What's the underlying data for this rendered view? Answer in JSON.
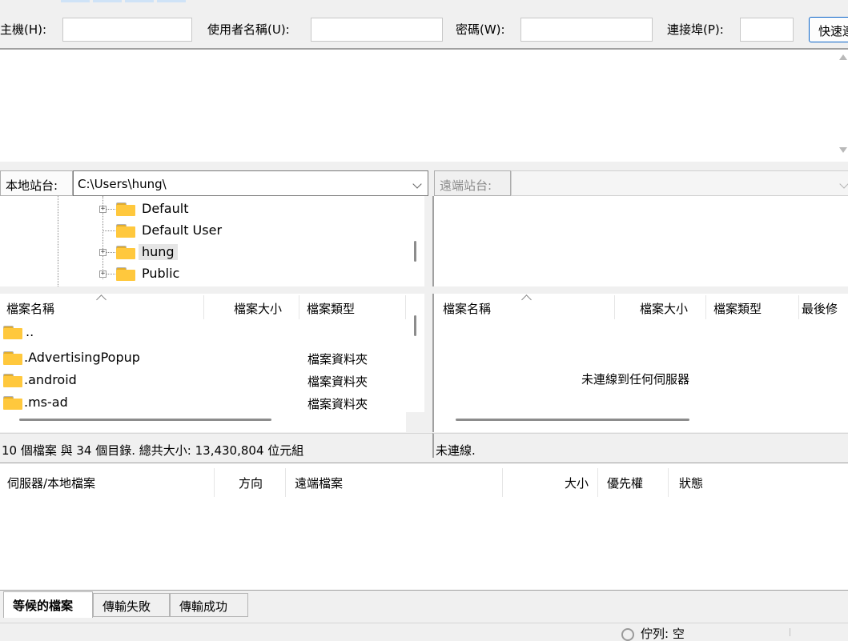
{
  "quickconnect": {
    "host_label": "主機(H):",
    "user_label": "使用者名稱(U):",
    "pass_label": "密碼(W):",
    "port_label": "連接埠(P):",
    "host_value": "",
    "user_value": "",
    "pass_value": "",
    "port_value": "",
    "connect_button": "快速連線"
  },
  "local_site": {
    "label": "本地站台:",
    "path": "C:\\Users\\hung\\",
    "tree": [
      {
        "name": "Default",
        "expandable": true
      },
      {
        "name": "Default User",
        "expandable": false
      },
      {
        "name": "hung",
        "expandable": true,
        "selected": true
      },
      {
        "name": "Public",
        "expandable": true
      }
    ]
  },
  "remote_site": {
    "label": "遠端站台:",
    "path": ""
  },
  "local_list": {
    "columns": [
      "檔案名稱",
      "檔案大小",
      "檔案類型"
    ],
    "rows": [
      {
        "name": "..",
        "type": ""
      },
      {
        "name": ".AdvertisingPopup",
        "type": "檔案資料夾"
      },
      {
        "name": ".android",
        "type": "檔案資料夾"
      },
      {
        "name": ".ms-ad",
        "type": "檔案資料夾"
      }
    ],
    "status": "10 個檔案 與 34 個目錄. 總共大小: 13,430,804 位元組"
  },
  "remote_list": {
    "columns": [
      "檔案名稱",
      "檔案大小",
      "檔案類型",
      "最後修"
    ],
    "empty_message": "未連線到任何伺服器",
    "status": "未連線."
  },
  "queue": {
    "columns": [
      "伺服器/本地檔案",
      "方向",
      "遠端檔案",
      "大小",
      "優先權",
      "狀態"
    ]
  },
  "tabs": [
    "等候的檔案",
    "傳輸失敗",
    "傳輸成功"
  ],
  "statusbar": {
    "text": "佇列: 空"
  },
  "colors": {
    "accent": "#0a64c8",
    "folder": "#ffc83d",
    "selection": "#e5e5e5"
  }
}
